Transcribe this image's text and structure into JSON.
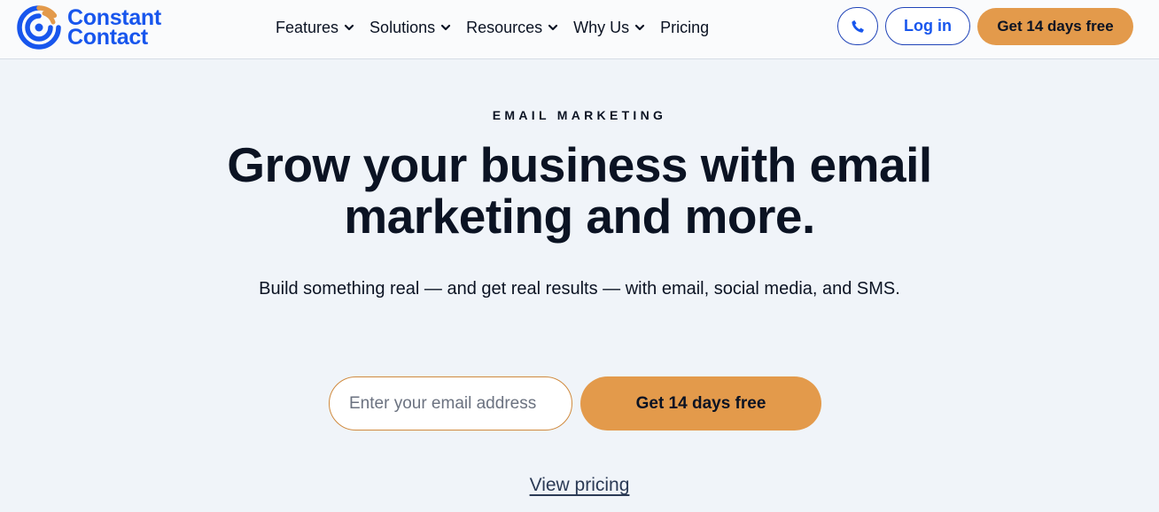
{
  "brand": {
    "name_line1": "Constant",
    "name_line2": "Contact",
    "logo_icon": "constant-contact-logo-icon",
    "colors": {
      "brand_blue": "#1856ed",
      "accent_orange": "#e39a4b",
      "dark_text": "#0b1323",
      "hero_bg": "#f0f4f9"
    }
  },
  "nav": {
    "items": [
      {
        "label": "Features",
        "has_dropdown": true
      },
      {
        "label": "Solutions",
        "has_dropdown": true
      },
      {
        "label": "Resources",
        "has_dropdown": true
      },
      {
        "label": "Why Us",
        "has_dropdown": true
      },
      {
        "label": "Pricing",
        "has_dropdown": false
      }
    ]
  },
  "header_actions": {
    "phone_icon": "phone-icon",
    "login_label": "Log in",
    "trial_label": "Get 14 days free"
  },
  "hero": {
    "eyebrow": "EMAIL MARKETING",
    "headline_line1": "Grow your business with email",
    "headline_line2": "marketing and more.",
    "subhead": "Build something real — and get real results — with email, social media, and SMS.",
    "email_placeholder": "Enter your email address",
    "email_value": "",
    "cta_label": "Get 14 days free",
    "pricing_link": "View pricing"
  }
}
